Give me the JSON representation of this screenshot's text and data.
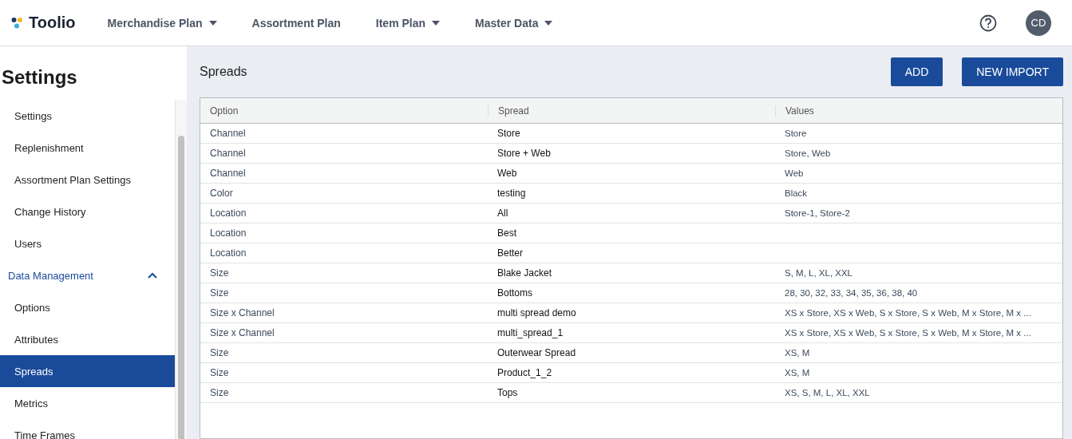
{
  "header": {
    "logo": "Toolio",
    "nav": [
      {
        "label": "Merchandise Plan",
        "dropdown": true
      },
      {
        "label": "Assortment Plan",
        "dropdown": false
      },
      {
        "label": "Item Plan",
        "dropdown": true
      },
      {
        "label": "Master Data",
        "dropdown": true
      }
    ],
    "avatar": "CD"
  },
  "sidebar": {
    "title": "Settings",
    "items": [
      {
        "label": "Settings",
        "kind": "item",
        "selected": false
      },
      {
        "label": "Replenishment",
        "kind": "item",
        "selected": false
      },
      {
        "label": "Assortment Plan Settings",
        "kind": "item",
        "selected": false
      },
      {
        "label": "Change History",
        "kind": "item",
        "selected": false
      },
      {
        "label": "Users",
        "kind": "item",
        "selected": false
      },
      {
        "label": "Data Management",
        "kind": "section",
        "expanded": true
      },
      {
        "label": "Options",
        "kind": "item",
        "selected": false
      },
      {
        "label": "Attributes",
        "kind": "item",
        "selected": false
      },
      {
        "label": "Spreads",
        "kind": "item",
        "selected": true
      },
      {
        "label": "Metrics",
        "kind": "item",
        "selected": false
      },
      {
        "label": "Time Frames",
        "kind": "item",
        "selected": false
      }
    ]
  },
  "page": {
    "title": "Spreads",
    "buttons": [
      "ADD",
      "NEW IMPORT"
    ]
  },
  "table": {
    "columns": [
      "Option",
      "Spread",
      "Values"
    ],
    "rows": [
      [
        "Channel",
        "Store",
        "Store"
      ],
      [
        "Channel",
        "Store + Web",
        "Store, Web"
      ],
      [
        "Channel",
        "Web",
        "Web"
      ],
      [
        "Color",
        "testing",
        "Black"
      ],
      [
        "Location",
        "All",
        "Store-1, Store-2"
      ],
      [
        "Location",
        "Best",
        ""
      ],
      [
        "Location",
        "Better",
        ""
      ],
      [
        "Size",
        "Blake Jacket",
        "S, M, L, XL, XXL"
      ],
      [
        "Size",
        "Bottoms",
        "28, 30, 32, 33, 34, 35, 36, 38, 40"
      ],
      [
        "Size x Channel",
        "multi spread demo",
        "XS x Store, XS x Web, S x Store, S x Web, M x Store, M x ..."
      ],
      [
        "Size x Channel",
        "multi_spread_1",
        "XS x Store, XS x Web, S x Store, S x Web, M x Store, M x ..."
      ],
      [
        "Size",
        "Outerwear Spread",
        "XS, M"
      ],
      [
        "Size",
        "Product_1_2",
        "XS, M"
      ],
      [
        "Size",
        "Tops",
        "XS, S, M, L, XL, XXL"
      ]
    ]
  }
}
